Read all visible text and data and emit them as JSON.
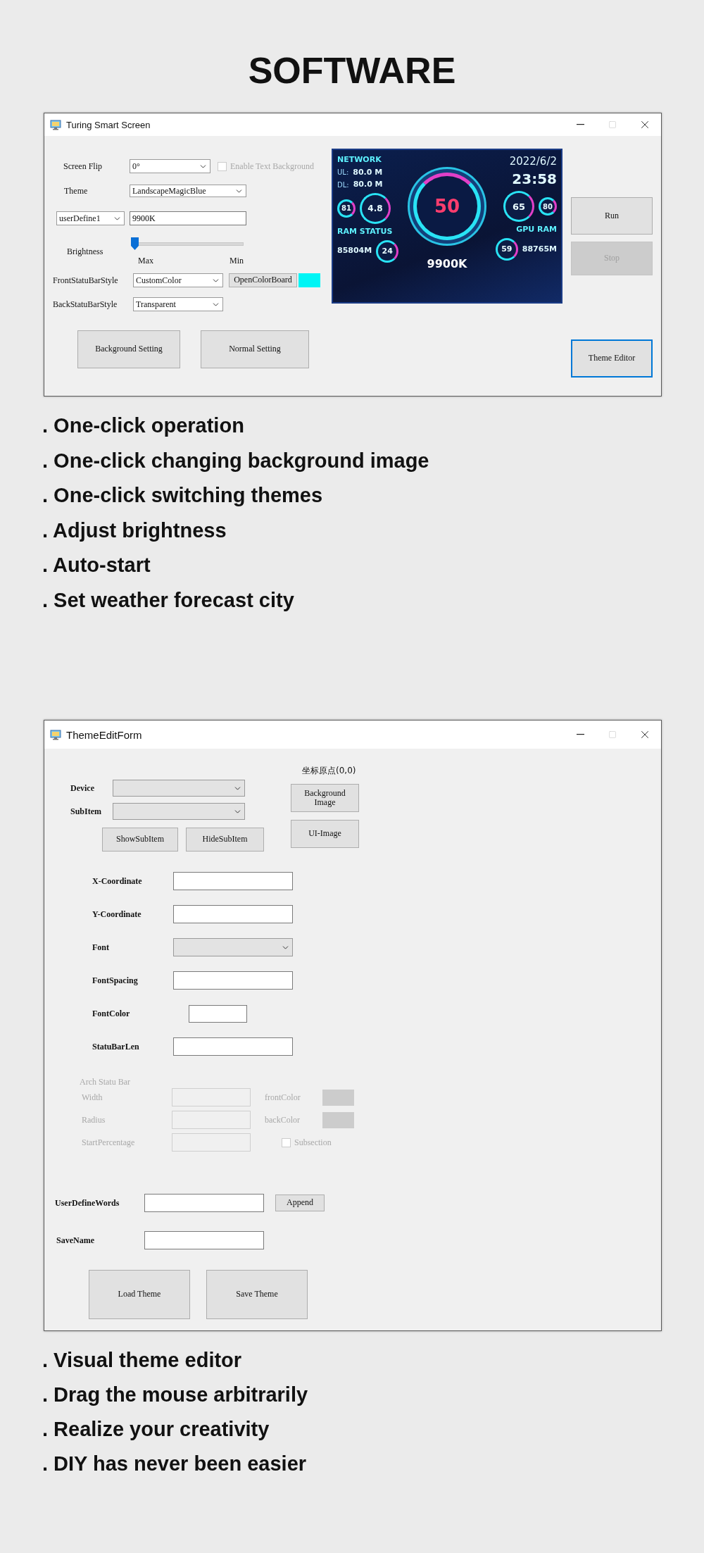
{
  "heading": "SOFTWARE",
  "main_window": {
    "title": "Turing Smart Screen",
    "screen_flip": {
      "label": "Screen Flip",
      "value": "0°"
    },
    "text_background": {
      "label": "Enable Text Background",
      "checked": false,
      "disabled": true
    },
    "theme": {
      "label": "Theme",
      "value": "LandscapeMagicBlue"
    },
    "profile": {
      "value": "userDefine1"
    },
    "cpu_name": {
      "value": "9900K"
    },
    "brightness": {
      "label": "Brightness",
      "level": 0,
      "start_label": "Max",
      "end_label": "Min"
    },
    "front_bar_style": {
      "label": "FrontStatuBarStyle",
      "value": "CustomColor"
    },
    "color_button": {
      "label": "OpenColorBoard"
    },
    "back_bar_style": {
      "label": "BackStatuBarStyle",
      "value": "Transparent"
    },
    "setting_buttons": [
      {
        "label": "Background Setting"
      },
      {
        "label": "Normal Setting"
      }
    ],
    "run_button": {
      "label": "Run",
      "disabled": false
    },
    "stop_button": {
      "label": "Stop",
      "disabled": true
    },
    "editor_button": {
      "label": "Theme Editor",
      "focused": true
    },
    "preview": {
      "network_title": "NETWORK",
      "upload": {
        "label": "UL:",
        "value": "80.0 M"
      },
      "download": {
        "label": "DL:",
        "value": "80.0 M"
      },
      "date": "2022/6/2",
      "time": "23:58",
      "center_value": "50",
      "left_gauges": [
        "81",
        "4.8"
      ],
      "right_gauges": [
        "65",
        "80"
      ],
      "ram_title": "RAM STATUS",
      "ram_value": "85804M",
      "ram_gauge": "24",
      "gpu_title": "GPU RAM",
      "gpu_value": "88765M",
      "gpu_gauge": "59",
      "cpu_name": "9900K"
    }
  },
  "features": [
    ". One-click operation",
    ". One-click changing background image",
    ". One-click switching themes",
    ". Adjust brightness",
    ". Auto-start",
    ". Set weather forecast city"
  ],
  "editor_window": {
    "title": "ThemeEditForm",
    "origin_label": "坐标原点(0,0)",
    "device": {
      "label": "Device"
    },
    "sub_item": {
      "label": "SubItem"
    },
    "show_button": "ShowSubItem",
    "hide_button": "HideSubItem",
    "image_buttons": [
      "Background Image",
      "UI-Image"
    ],
    "fields": [
      {
        "label": "X-Coordinate",
        "kind": "text"
      },
      {
        "label": "Y-Coordinate",
        "kind": "text"
      },
      {
        "label": "Font",
        "kind": "select"
      },
      {
        "label": "FontSpacing",
        "kind": "text"
      },
      {
        "label": "FontColor",
        "kind": "color"
      },
      {
        "label": "StatuBarLen",
        "kind": "text"
      }
    ],
    "arch_section": {
      "title": "Arch Statu Bar",
      "disabled": true,
      "fields": [
        "Width",
        "Radius",
        "StartPercentage"
      ],
      "color_labels": [
        "frontColor",
        "backColor"
      ],
      "subsection": {
        "label": "Subsection",
        "checked": false
      }
    },
    "user_words": {
      "label": "UserDefineWords",
      "button": "Append"
    },
    "save_name": {
      "label": "SaveName"
    },
    "theme_buttons": [
      "Load Theme",
      "Save Theme"
    ]
  },
  "editor_features": [
    ". Visual theme editor",
    ". Drag the mouse arbitrarily",
    ". Realize your creativity",
    ". DIY has never been easier"
  ]
}
